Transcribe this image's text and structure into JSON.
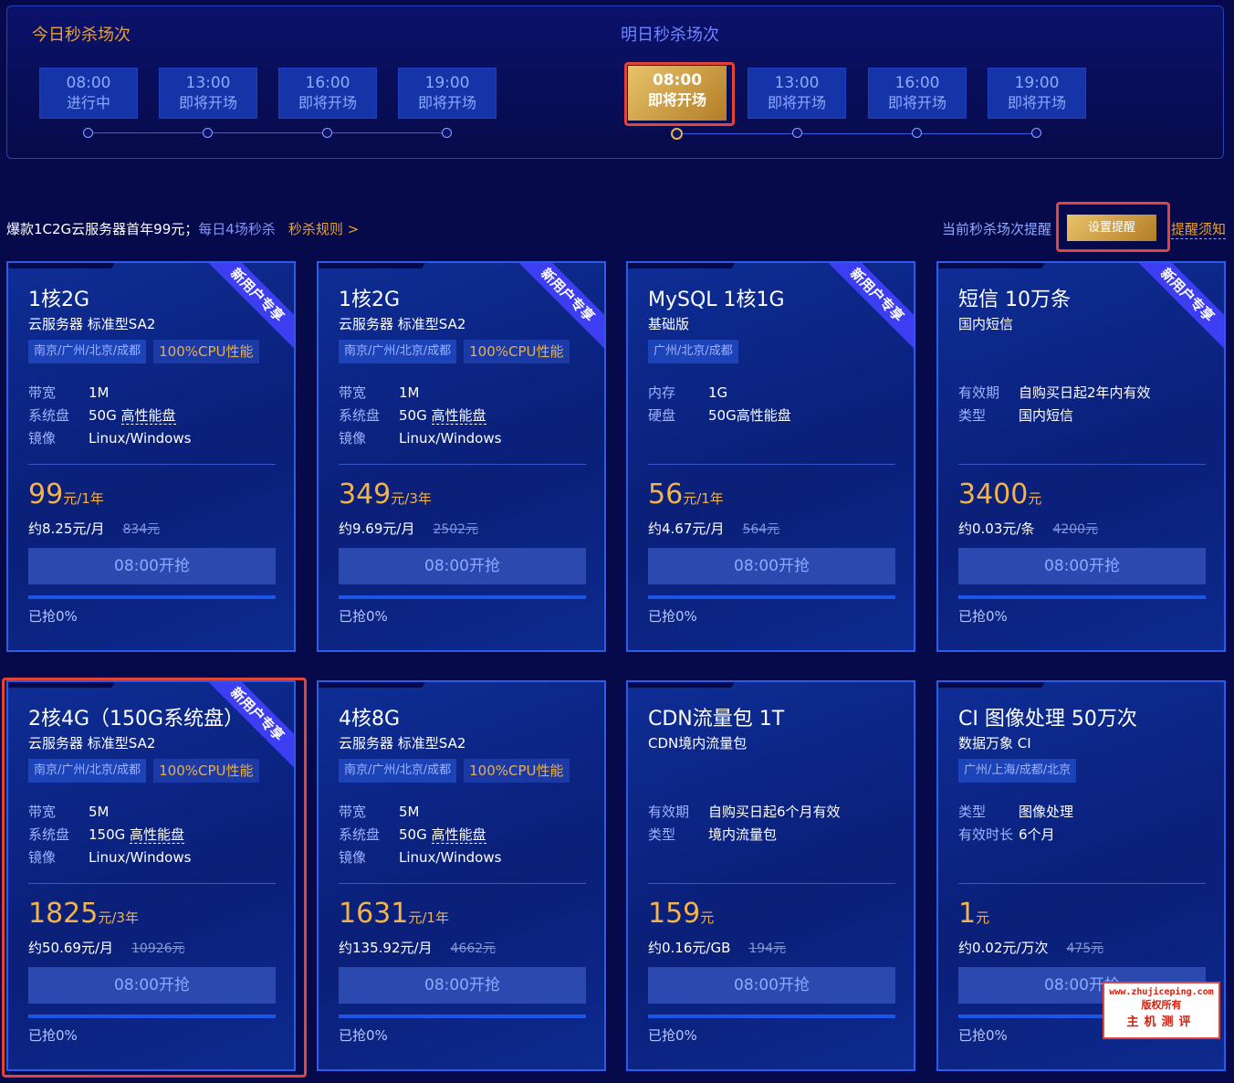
{
  "today": {
    "title": "今日秒杀场次",
    "slots": [
      {
        "time": "08:00",
        "status": "进行中"
      },
      {
        "time": "13:00",
        "status": "即将开场"
      },
      {
        "time": "16:00",
        "status": "即将开场"
      },
      {
        "time": "19:00",
        "status": "即将开场"
      }
    ]
  },
  "tomorrow": {
    "title": "明日秒杀场次",
    "slots": [
      {
        "time": "08:00",
        "status": "即将开场"
      },
      {
        "time": "13:00",
        "status": "即将开场"
      },
      {
        "time": "16:00",
        "status": "即将开场"
      },
      {
        "time": "19:00",
        "status": "即将开场"
      }
    ]
  },
  "promo": {
    "headline": "爆款1C2G云服务器首年99元；",
    "sub": "每日4场秒杀",
    "rule": "秒杀规则 >"
  },
  "remind": {
    "label": "当前秒杀场次提醒",
    "button": "设置提醒",
    "notice": "提醒须知"
  },
  "cards": [
    {
      "title": "1核2G",
      "sub": "云服务器 标准型SA2",
      "ribbon": "新用户专享",
      "tags": [
        "南京/广州/北京/成都",
        "100%CPU性能"
      ],
      "specs": [
        {
          "k": "带宽",
          "v": "1M"
        },
        {
          "k": "系统盘",
          "v": "50G",
          "v2": "高性能盘"
        },
        {
          "k": "镜像",
          "v": "Linux/Windows"
        }
      ],
      "price": "99",
      "unit": "元/1年",
      "monthly": "约8.25元/月",
      "orig": "834元",
      "buy": "08:00开抢",
      "grabbed": "已抢0%"
    },
    {
      "title": "1核2G",
      "sub": "云服务器 标准型SA2",
      "ribbon": "新用户专享",
      "tags": [
        "南京/广州/北京/成都",
        "100%CPU性能"
      ],
      "specs": [
        {
          "k": "带宽",
          "v": "1M"
        },
        {
          "k": "系统盘",
          "v": "50G",
          "v2": "高性能盘"
        },
        {
          "k": "镜像",
          "v": "Linux/Windows"
        }
      ],
      "price": "349",
      "unit": "元/3年",
      "monthly": "约9.69元/月",
      "orig": "2502元",
      "buy": "08:00开抢",
      "grabbed": "已抢0%"
    },
    {
      "title": "MySQL 1核1G",
      "sub": "基础版",
      "ribbon": "新用户专享",
      "tags": [
        "广州/北京/成都"
      ],
      "specs": [
        {
          "k": "内存",
          "v": "1G"
        },
        {
          "k": "硬盘",
          "v": "50G高性能盘"
        }
      ],
      "price": "56",
      "unit": "元/1年",
      "monthly": "约4.67元/月",
      "orig": "564元",
      "buy": "08:00开抢",
      "grabbed": "已抢0%"
    },
    {
      "title": "短信 10万条",
      "sub": "国内短信",
      "ribbon": "新用户专享",
      "tags": [],
      "specs": [
        {
          "k": "有效期",
          "v": "自购买日起2年内有效"
        },
        {
          "k": "类型",
          "v": "国内短信"
        }
      ],
      "price": "3400",
      "unit": "元",
      "monthly": "约0.03元/条",
      "orig": "4200元",
      "buy": "08:00开抢",
      "grabbed": "已抢0%"
    },
    {
      "title": "2核4G（150G系统盘）",
      "sub": "云服务器 标准型SA2",
      "ribbon": "新用户专享",
      "tags": [
        "南京/广州/北京/成都",
        "100%CPU性能"
      ],
      "specs": [
        {
          "k": "带宽",
          "v": "5M"
        },
        {
          "k": "系统盘",
          "v": "150G",
          "v2": "高性能盘"
        },
        {
          "k": "镜像",
          "v": "Linux/Windows"
        }
      ],
      "price": "1825",
      "unit": "元/3年",
      "monthly": "约50.69元/月",
      "orig": "10926元",
      "buy": "08:00开抢",
      "grabbed": "已抢0%"
    },
    {
      "title": "4核8G",
      "sub": "云服务器 标准型SA2",
      "ribbon": "",
      "tags": [
        "南京/广州/北京/成都",
        "100%CPU性能"
      ],
      "specs": [
        {
          "k": "带宽",
          "v": "5M"
        },
        {
          "k": "系统盘",
          "v": "50G",
          "v2": "高性能盘"
        },
        {
          "k": "镜像",
          "v": "Linux/Windows"
        }
      ],
      "price": "1631",
      "unit": "元/1年",
      "monthly": "约135.92元/月",
      "orig": "4662元",
      "buy": "08:00开抢",
      "grabbed": "已抢0%"
    },
    {
      "title": "CDN流量包 1T",
      "sub": "CDN境内流量包",
      "ribbon": "",
      "tags": [],
      "specs": [
        {
          "k": "有效期",
          "v": "自购买日起6个月有效"
        },
        {
          "k": "类型",
          "v": "境内流量包"
        }
      ],
      "price": "159",
      "unit": "元",
      "monthly": "约0.16元/GB",
      "orig": "194元",
      "buy": "08:00开抢",
      "grabbed": "已抢0%"
    },
    {
      "title": "CI 图像处理 50万次",
      "sub": "数据万象 CI",
      "ribbon": "",
      "tags": [
        "广州/上海/成都/北京"
      ],
      "specs": [
        {
          "k": "类型",
          "v": "图像处理"
        },
        {
          "k": "有效时长",
          "v": "6个月"
        }
      ],
      "price": "1",
      "unit": "元",
      "monthly": "约0.02元/万次",
      "orig": "475元",
      "buy": "08:00开抢",
      "grabbed": "已抢0%"
    }
  ],
  "watermark": {
    "line1": "www.zhujiceping.com",
    "line2": "版权所有",
    "line3": "主机测评"
  }
}
